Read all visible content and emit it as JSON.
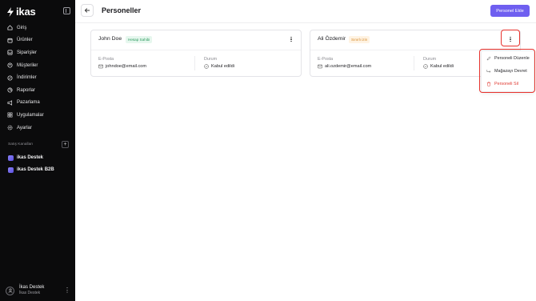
{
  "app": {
    "brand": "ikas"
  },
  "sidebar": {
    "items": [
      {
        "label": "Giriş",
        "icon": "home-icon"
      },
      {
        "label": "Ürünler",
        "icon": "box-icon"
      },
      {
        "label": "Siparişler",
        "icon": "inbox-icon"
      },
      {
        "label": "Müşteriler",
        "icon": "users-icon"
      },
      {
        "label": "İndirimler",
        "icon": "discount-icon"
      },
      {
        "label": "Raporlar",
        "icon": "chart-icon"
      },
      {
        "label": "Pazarlama",
        "icon": "megaphone-icon"
      },
      {
        "label": "Uygulamalar",
        "icon": "apps-icon"
      },
      {
        "label": "Ayarlar",
        "icon": "gear-icon"
      }
    ],
    "channels_title": "Satış Kanalları",
    "channels": [
      {
        "label": "ikas Destek"
      },
      {
        "label": "ikas Destek B2B"
      }
    ],
    "user": {
      "name": "İkas Destek",
      "subtitle": "İkas Destek"
    }
  },
  "header": {
    "title": "Personeller",
    "add_button": "Personel Ekle"
  },
  "staff": [
    {
      "name": "John Doe",
      "badge": "Hesap Sahibi",
      "email_label": "E-Posta",
      "email": "johndoe@email.com",
      "status_label": "Durum",
      "status": "Kabul edildi"
    },
    {
      "name": "Ali Özdemir",
      "badge": "Sınırlı izin",
      "email_label": "E-Posta",
      "email": "ali.ozdemir@email.com",
      "status_label": "Durum",
      "status": "Kabul edildi"
    }
  ],
  "dropdown": {
    "items": [
      {
        "label": "Personeli Düzenle",
        "icon": "pencil-icon"
      },
      {
        "label": "Mağazayı Devret",
        "icon": "transfer-icon"
      },
      {
        "label": "Personeli Sil",
        "icon": "trash-icon"
      }
    ]
  },
  "colors": {
    "accent": "#6f5ff0",
    "sidebar_bg": "#0b0b0c",
    "highlight": "#e8332e",
    "danger": "#e03a32",
    "owner_badge": "#2d9a5f",
    "invite_badge": "#d48a2a"
  }
}
